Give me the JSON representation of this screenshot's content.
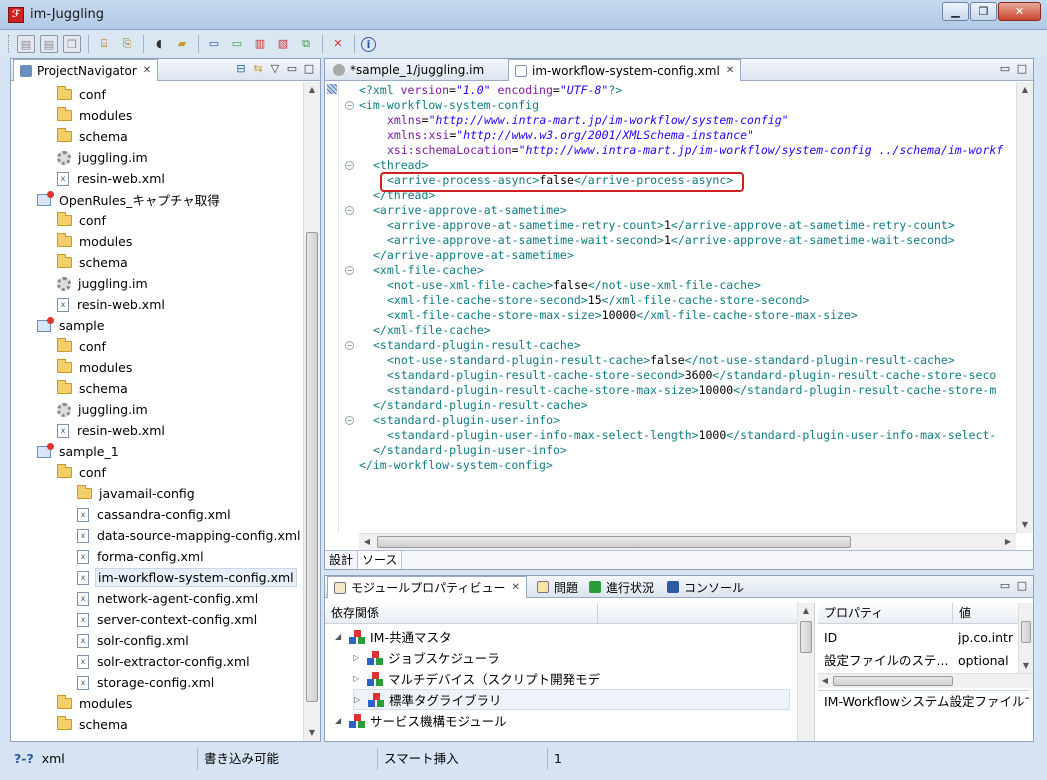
{
  "window": {
    "title": "im-Juggling"
  },
  "toolbar": {
    "buttons": [
      "save-icon",
      "save-all-icon",
      "copy-icon",
      "build-icon",
      "deploy-icon",
      "server-icon",
      "open-folder-icon",
      "monitor-icon",
      "add-server-icon",
      "chart-icon",
      "image-icon",
      "network-icon",
      "tools-icon",
      "info-icon"
    ]
  },
  "navigator": {
    "tab_label": "ProjectNavigator",
    "items": [
      {
        "label": "conf",
        "kind": "folder",
        "indent": 1
      },
      {
        "label": "modules",
        "kind": "folder",
        "indent": 1
      },
      {
        "label": "schema",
        "kind": "folder",
        "indent": 1
      },
      {
        "label": "juggling.im",
        "kind": "gear",
        "indent": 1
      },
      {
        "label": "resin-web.xml",
        "kind": "xml",
        "indent": 1
      },
      {
        "label": "OpenRules_キャプチャ取得",
        "kind": "project",
        "indent": 0
      },
      {
        "label": "conf",
        "kind": "folder",
        "indent": 1
      },
      {
        "label": "modules",
        "kind": "folder",
        "indent": 1
      },
      {
        "label": "schema",
        "kind": "folder",
        "indent": 1
      },
      {
        "label": "juggling.im",
        "kind": "gear",
        "indent": 1
      },
      {
        "label": "resin-web.xml",
        "kind": "xml",
        "indent": 1
      },
      {
        "label": "sample",
        "kind": "project",
        "indent": 0
      },
      {
        "label": "conf",
        "kind": "folder",
        "indent": 1
      },
      {
        "label": "modules",
        "kind": "folder",
        "indent": 1
      },
      {
        "label": "schema",
        "kind": "folder",
        "indent": 1
      },
      {
        "label": "juggling.im",
        "kind": "gear",
        "indent": 1
      },
      {
        "label": "resin-web.xml",
        "kind": "xml",
        "indent": 1
      },
      {
        "label": "sample_1",
        "kind": "project",
        "indent": 0
      },
      {
        "label": "conf",
        "kind": "folder",
        "indent": 1
      },
      {
        "label": "javamail-config",
        "kind": "folder",
        "indent": 2
      },
      {
        "label": "cassandra-config.xml",
        "kind": "xml",
        "indent": 2
      },
      {
        "label": "data-source-mapping-config.xml",
        "kind": "xml",
        "indent": 2
      },
      {
        "label": "forma-config.xml",
        "kind": "xml",
        "indent": 2
      },
      {
        "label": "im-workflow-system-config.xml",
        "kind": "xml",
        "indent": 2,
        "selected": true
      },
      {
        "label": "network-agent-config.xml",
        "kind": "xml",
        "indent": 2
      },
      {
        "label": "server-context-config.xml",
        "kind": "xml",
        "indent": 2
      },
      {
        "label": "solr-config.xml",
        "kind": "xml",
        "indent": 2
      },
      {
        "label": "solr-extractor-config.xml",
        "kind": "xml",
        "indent": 2
      },
      {
        "label": "storage-config.xml",
        "kind": "xml",
        "indent": 2
      },
      {
        "label": "modules",
        "kind": "folder",
        "indent": 1
      },
      {
        "label": "schema",
        "kind": "folder",
        "indent": 1
      }
    ]
  },
  "editor": {
    "tabs": [
      {
        "label": "*sample_1/juggling.im",
        "active": false
      },
      {
        "label": "im-workflow-system-config.xml",
        "active": true
      }
    ],
    "bottom_tabs": [
      "設計",
      "ソース"
    ],
    "lines": [
      {
        "indent": 0,
        "fold": false,
        "parts": [
          [
            "pi",
            "<?xml "
          ],
          [
            "attrname",
            "version"
          ],
          [
            "txt",
            "="
          ],
          [
            "attrval",
            "\"1.0\""
          ],
          [
            "txt",
            " "
          ],
          [
            "attrname",
            "encoding"
          ],
          [
            "txt",
            "="
          ],
          [
            "attrval",
            "\"UTF-8\""
          ],
          [
            "pi",
            "?>"
          ]
        ]
      },
      {
        "indent": 0,
        "fold": true,
        "parts": [
          [
            "tag",
            "<im-workflow-system-config"
          ]
        ]
      },
      {
        "indent": 2,
        "fold": false,
        "parts": [
          [
            "attrname",
            "xmlns"
          ],
          [
            "txt",
            "="
          ],
          [
            "attrval",
            "\"http://www.intra-mart.jp/im-workflow/system-config\""
          ]
        ]
      },
      {
        "indent": 2,
        "fold": false,
        "parts": [
          [
            "attrname",
            "xmlns:xsi"
          ],
          [
            "txt",
            "="
          ],
          [
            "attrval",
            "\"http://www.w3.org/2001/XMLSchema-instance\""
          ]
        ]
      },
      {
        "indent": 2,
        "fold": false,
        "parts": [
          [
            "attrname",
            "xsi:schemaLocation"
          ],
          [
            "txt",
            "="
          ],
          [
            "attrval",
            "\"http://www.intra-mart.jp/im-workflow/system-config ../schema/im-workf"
          ]
        ]
      },
      {
        "indent": 1,
        "fold": true,
        "parts": [
          [
            "tag",
            "<thread>"
          ]
        ]
      },
      {
        "indent": 2,
        "fold": false,
        "parts": [
          [
            "tag",
            "<arrive-process-async>"
          ],
          [
            "txt",
            "false"
          ],
          [
            "tag",
            "</arrive-process-async>"
          ]
        ]
      },
      {
        "indent": 1,
        "fold": false,
        "parts": [
          [
            "tag",
            "</thread>"
          ]
        ]
      },
      {
        "indent": 1,
        "fold": true,
        "parts": [
          [
            "tag",
            "<arrive-approve-at-sametime>"
          ]
        ]
      },
      {
        "indent": 2,
        "fold": false,
        "parts": [
          [
            "tag",
            "<arrive-approve-at-sametime-retry-count>"
          ],
          [
            "txt",
            "1"
          ],
          [
            "tag",
            "</arrive-approve-at-sametime-retry-count>"
          ]
        ]
      },
      {
        "indent": 2,
        "fold": false,
        "parts": [
          [
            "tag",
            "<arrive-approve-at-sametime-wait-second>"
          ],
          [
            "txt",
            "1"
          ],
          [
            "tag",
            "</arrive-approve-at-sametime-wait-second>"
          ]
        ]
      },
      {
        "indent": 1,
        "fold": false,
        "parts": [
          [
            "tag",
            "</arrive-approve-at-sametime>"
          ]
        ]
      },
      {
        "indent": 1,
        "fold": true,
        "parts": [
          [
            "tag",
            "<xml-file-cache>"
          ]
        ]
      },
      {
        "indent": 2,
        "fold": false,
        "parts": [
          [
            "tag",
            "<not-use-xml-file-cache>"
          ],
          [
            "txt",
            "false"
          ],
          [
            "tag",
            "</not-use-xml-file-cache>"
          ]
        ]
      },
      {
        "indent": 2,
        "fold": false,
        "parts": [
          [
            "tag",
            "<xml-file-cache-store-second>"
          ],
          [
            "txt",
            "15"
          ],
          [
            "tag",
            "</xml-file-cache-store-second>"
          ]
        ]
      },
      {
        "indent": 2,
        "fold": false,
        "parts": [
          [
            "tag",
            "<xml-file-cache-store-max-size>"
          ],
          [
            "txt",
            "10000"
          ],
          [
            "tag",
            "</xml-file-cache-store-max-size>"
          ]
        ]
      },
      {
        "indent": 1,
        "fold": false,
        "parts": [
          [
            "tag",
            "</xml-file-cache>"
          ]
        ]
      },
      {
        "indent": 1,
        "fold": true,
        "parts": [
          [
            "tag",
            "<standard-plugin-result-cache>"
          ]
        ]
      },
      {
        "indent": 2,
        "fold": false,
        "parts": [
          [
            "tag",
            "<not-use-standard-plugin-result-cache>"
          ],
          [
            "txt",
            "false"
          ],
          [
            "tag",
            "</not-use-standard-plugin-result-cache>"
          ]
        ]
      },
      {
        "indent": 2,
        "fold": false,
        "parts": [
          [
            "tag",
            "<standard-plugin-result-cache-store-second>"
          ],
          [
            "txt",
            "3600"
          ],
          [
            "tag",
            "</standard-plugin-result-cache-store-seco"
          ]
        ]
      },
      {
        "indent": 2,
        "fold": false,
        "parts": [
          [
            "tag",
            "<standard-plugin-result-cache-store-max-size>"
          ],
          [
            "txt",
            "10000"
          ],
          [
            "tag",
            "</standard-plugin-result-cache-store-m"
          ]
        ]
      },
      {
        "indent": 1,
        "fold": false,
        "parts": [
          [
            "tag",
            "</standard-plugin-result-cache>"
          ]
        ]
      },
      {
        "indent": 1,
        "fold": true,
        "parts": [
          [
            "tag",
            "<standard-plugin-user-info>"
          ]
        ]
      },
      {
        "indent": 2,
        "fold": false,
        "parts": [
          [
            "tag",
            "<standard-plugin-user-info-max-select-length>"
          ],
          [
            "txt",
            "1000"
          ],
          [
            "tag",
            "</standard-plugin-user-info-max-select-"
          ]
        ]
      },
      {
        "indent": 1,
        "fold": false,
        "parts": [
          [
            "tag",
            "</standard-plugin-user-info>"
          ]
        ]
      },
      {
        "indent": 0,
        "fold": false,
        "parts": [
          [
            "tag",
            "</im-workflow-system-config>"
          ]
        ]
      }
    ]
  },
  "bottom_panel": {
    "tabs": [
      "モジュールプロパティビュー",
      "問題",
      "進行状況",
      "コンソール"
    ],
    "dependency_header": "依存関係",
    "tree": [
      {
        "label": "IM-共通マスタ",
        "depth": 0,
        "expanded": true
      },
      {
        "label": "ジョブスケジューラ",
        "depth": 1,
        "expanded": false
      },
      {
        "label": "マルチデバイス（スクリプト開発モデ",
        "depth": 1,
        "expanded": false
      },
      {
        "label": "標準タグライブラリ",
        "depth": 1,
        "expanded": false,
        "selected": true
      },
      {
        "label": "サービス機構モジュール",
        "depth": 0,
        "expanded": true
      }
    ],
    "property_headers": [
      "プロパティ",
      "値"
    ],
    "properties": [
      {
        "name": "ID",
        "value": "jp.co.intr"
      },
      {
        "name": "設定ファイルのステ...",
        "value": "optional"
      }
    ],
    "description": "IM-Workflowシステム設定ファイルで"
  },
  "status": {
    "file_type": "xml",
    "writable": "書き込み可能",
    "insert_mode": "スマート挿入",
    "line": "1"
  },
  "colors": {
    "highlight": "#d02020",
    "tag": "#0f7c82",
    "attr": "#7a1aa0",
    "value": "#2a00ff"
  }
}
